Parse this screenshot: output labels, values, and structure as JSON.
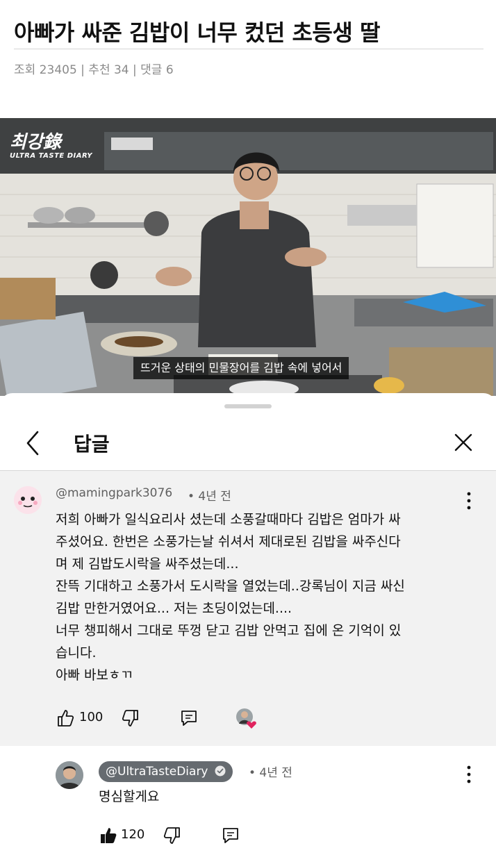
{
  "post": {
    "title": "아빠가 싸준 김밥이 너무 컸던 초등생 딸",
    "meta": "조회 23405 | 추천 34 | 댓글 6"
  },
  "video": {
    "channel_logo": "최강錄",
    "channel_logo_sub": "ULTRA TASTE DIARY",
    "subtitle": "뜨거운 상태의 민물장어를 김밥 속에 넣어서"
  },
  "sheet": {
    "title": "답글",
    "back_icon": "chevron-left-icon",
    "close_icon": "close-icon"
  },
  "comment": {
    "author": "@mamingpark3076",
    "time": "• 4년 전",
    "lines": [
      "저희 아빠가 일식요리사 셨는데 소풍갈때마다 김밥은 엄마가 싸",
      "주셨어요. 한번은 소풍가는날 쉬셔서 제대로된 김밥을 싸주신다",
      "며 제 김밥도시락을 싸주셨는데...",
      "잔뜩 기대하고 소풍가서 도시락을 열었는데..강록님이 지금 싸신",
      "김밥 만한거였어요... 저는 초딩이었는데....",
      "너무 챙피해서 그대로 뚜껑 닫고 김밥 안먹고 집에 온 기억이 있",
      "습니다.",
      "아빠 바보ㅎㄲ"
    ],
    "likes": "100",
    "hearted_by_creator": true
  },
  "reply": {
    "author": "@UltraTasteDiary",
    "verified_icon": "verified-check-icon",
    "time": "• 4년 전",
    "text": "명심할게요",
    "likes": "120",
    "liked": true
  },
  "colors": {
    "comment_bg": "#f2f2f2",
    "creator_chip": "#666b70",
    "heart": "#e0245e",
    "meta_text": "#8a8a8a"
  }
}
